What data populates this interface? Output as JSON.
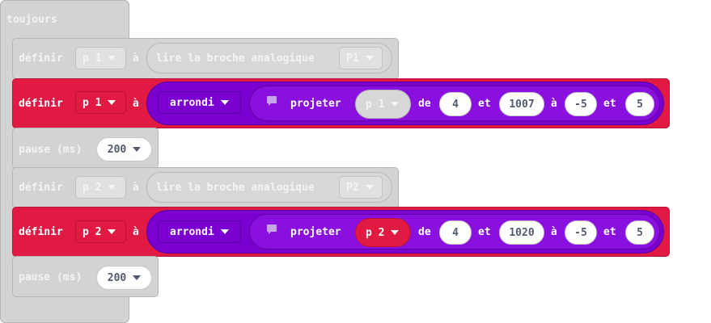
{
  "forever": {
    "label": "toujours"
  },
  "blocks": [
    {
      "set_label": "définir",
      "var": "p 1",
      "to": "à",
      "read": "lire la broche analogique",
      "pin": "P1"
    },
    {
      "set_label": "définir",
      "var": "p 1",
      "to": "à",
      "round": "arrondi",
      "map": "projeter",
      "map_var": "p 1",
      "from_lbl": "de",
      "from_low": "4",
      "and1": "et",
      "from_high": "1007",
      "to_lbl": "à",
      "to_low": "-5",
      "and2": "et",
      "to_high": "5"
    },
    {
      "pause_label": "pause (ms)",
      "ms": "200"
    },
    {
      "set_label": "définir",
      "var": "p 2",
      "to": "à",
      "read": "lire la broche analogique",
      "pin": "P2"
    },
    {
      "set_label": "définir",
      "var": "p 2",
      "to": "à",
      "round": "arrondi",
      "map": "projeter",
      "map_var": "p 2",
      "from_lbl": "de",
      "from_low": "4",
      "and1": "et",
      "from_high": "1020",
      "to_lbl": "à",
      "to_low": "-5",
      "and2": "et",
      "to_high": "5"
    },
    {
      "pause_label": "pause (ms)",
      "ms": "200"
    }
  ]
}
